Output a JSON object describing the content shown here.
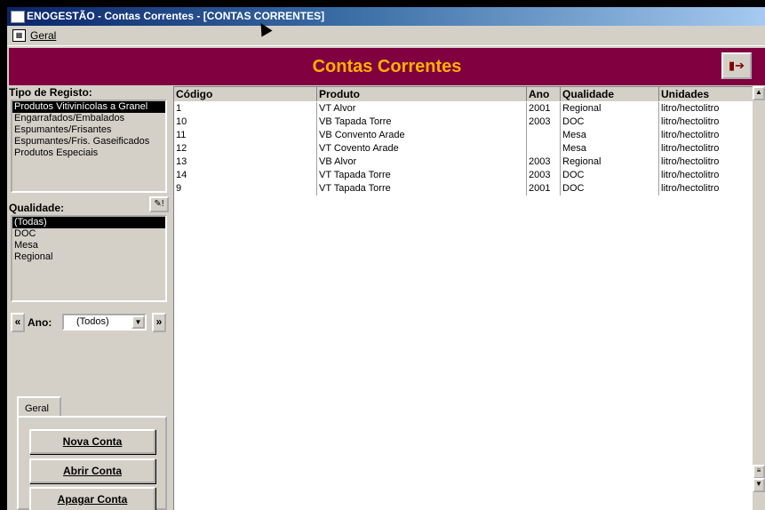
{
  "window": {
    "title": "ENOGESTÃO - Contas Correntes - [CONTAS CORRENTES]"
  },
  "menu": {
    "items": [
      "Geral"
    ]
  },
  "header": {
    "title": "Contas Correntes",
    "exit_icon": "exit-door-icon"
  },
  "left_panel": {
    "tipo_label": "Tipo de Registo:",
    "tipo_items": [
      "Produtos Vitivinícolas a Granel",
      "Engarrafados/Embalados",
      "Espumantes/Frisantes",
      "Espumantes/Fris. Gaseificados",
      "Produtos Especiais"
    ],
    "qualidade_label": "Qualidade:",
    "qualidade_items": [
      "(Todas)",
      "DOC",
      "Mesa",
      "Regional"
    ],
    "ano_label": "Ano:",
    "ano_value": "(Todos)",
    "prev_label": "«",
    "next_label": "»",
    "tab_label": "Geral",
    "buttons": [
      "Nova Conta",
      "Abrir Conta",
      "Apagar Conta"
    ]
  },
  "grid": {
    "columns": [
      "Código",
      "Produto",
      "Ano",
      "Qualidade",
      "Unidades"
    ],
    "rows": [
      [
        "1",
        "VT Alvor",
        "2001",
        "Regional",
        "litro/hectolitro"
      ],
      [
        "10",
        "VB Tapada Torre",
        "2003",
        "DOC",
        "litro/hectolitro"
      ],
      [
        "11",
        "VB Convento Arade",
        "",
        "Mesa",
        "litro/hectolitro"
      ],
      [
        "12",
        "VT Covento Arade",
        "",
        "Mesa",
        "litro/hectolitro"
      ],
      [
        "13",
        "VB Alvor",
        "2003",
        "Regional",
        "litro/hectolitro"
      ],
      [
        "14",
        "VT Tapada Torre",
        "2003",
        "DOC",
        "litro/hectolitro"
      ],
      [
        "9",
        "VT Tapada Torre",
        "2001",
        "DOC",
        "litro/hectolitro"
      ]
    ]
  }
}
